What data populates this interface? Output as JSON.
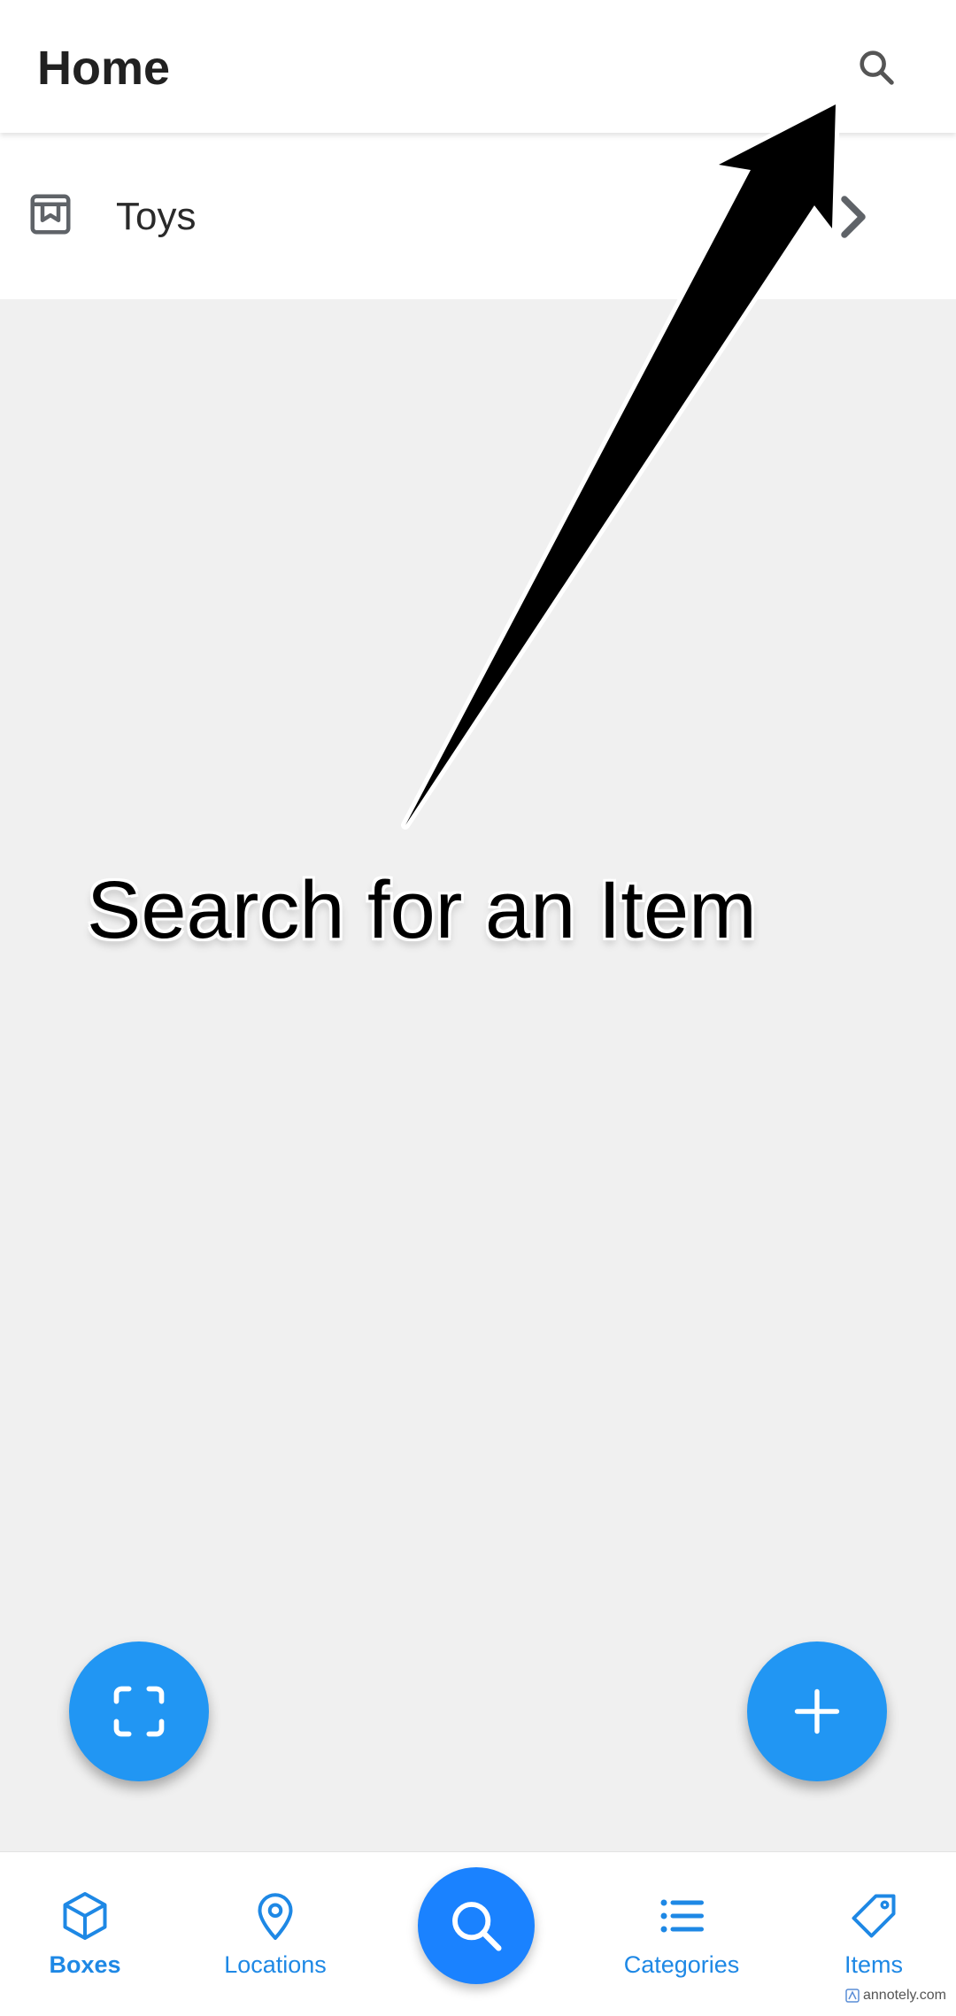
{
  "header": {
    "title": "Home",
    "search_icon": "search-icon"
  },
  "list": {
    "items": [
      {
        "label": "Toys",
        "icon": "archive-box-icon",
        "trailing_icon": "chevron-right-icon"
      }
    ]
  },
  "fabs": {
    "scan_icon": "scan-frame-icon",
    "add_icon": "plus-icon"
  },
  "bottom_nav": {
    "items": [
      {
        "label": "Boxes",
        "icon": "cube-icon",
        "active": true
      },
      {
        "label": "Locations",
        "icon": "map-pin-icon"
      },
      {
        "label": "Categories",
        "icon": "list-icon"
      },
      {
        "label": "Items",
        "icon": "tag-icon"
      }
    ],
    "center_icon": "search-icon"
  },
  "annotation": {
    "text": "Search for an Item",
    "arrow_icon": "arrow-icon"
  },
  "watermark": {
    "text": "annotely.com"
  },
  "colors": {
    "accent": "#2196f3",
    "nav_accent": "#1e88e5",
    "center_fab": "#1a82ff",
    "background": "#f0f0f0",
    "annotation": "#000000"
  }
}
